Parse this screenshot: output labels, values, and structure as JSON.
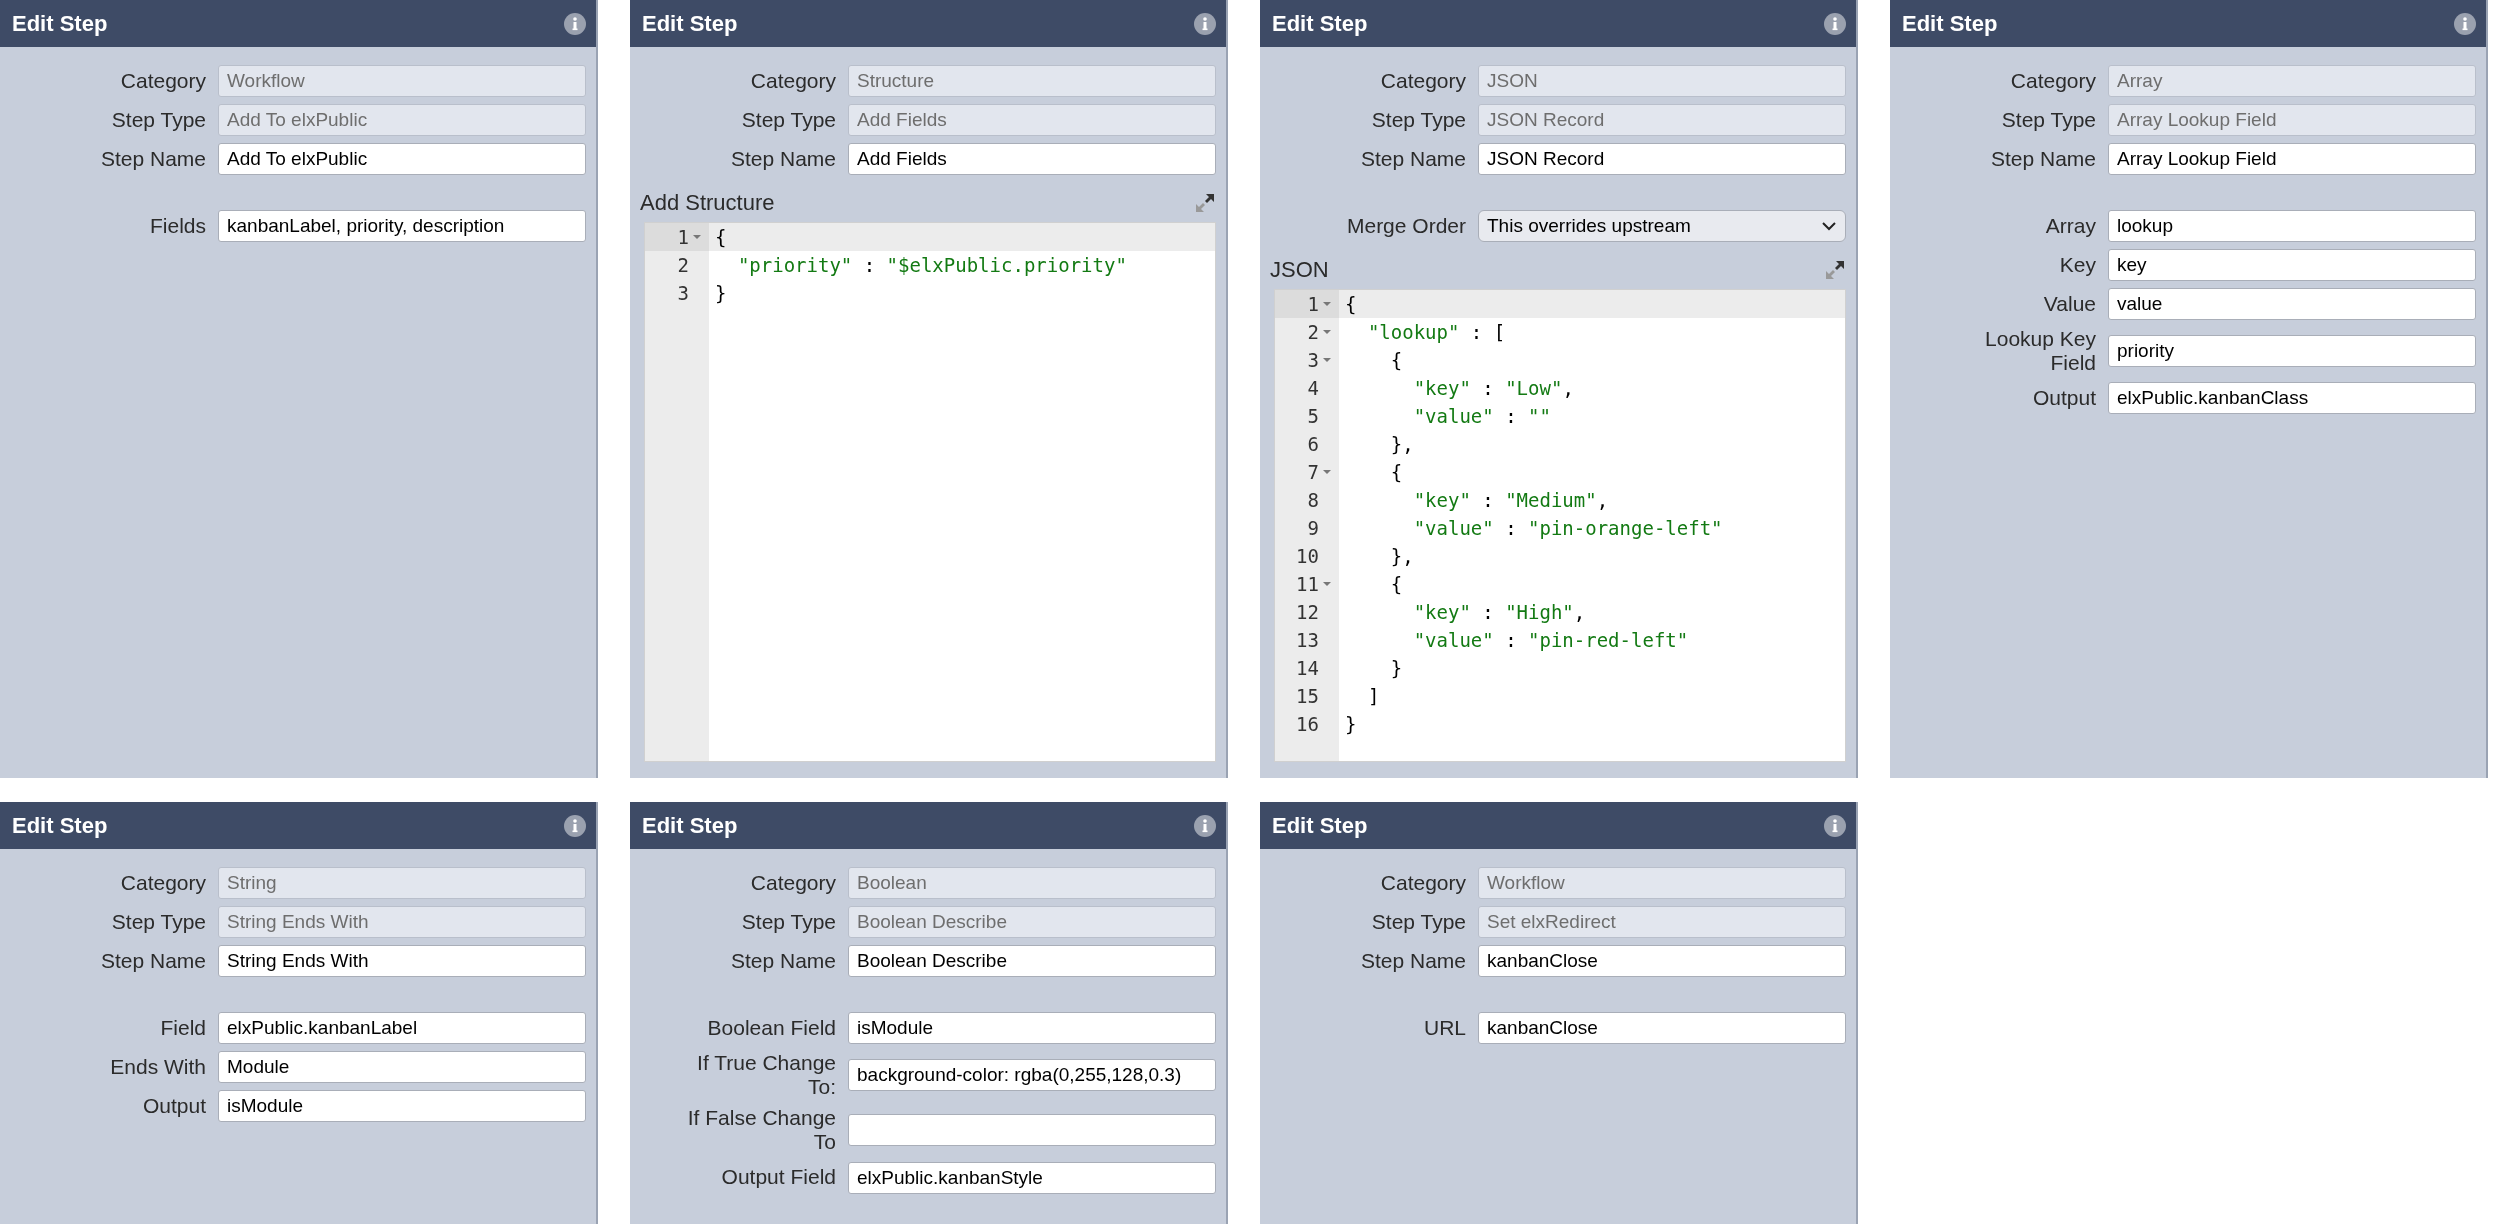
{
  "panels": [
    {
      "title": "Edit Step",
      "fields": [
        {
          "label": "Category",
          "value": "Workflow",
          "kind": "text",
          "readonly": true
        },
        {
          "label": "Step Type",
          "value": "Add To elxPublic",
          "kind": "text",
          "readonly": true
        },
        {
          "label": "Step Name",
          "value": "Add To elxPublic",
          "kind": "text",
          "readonly": false
        }
      ],
      "extra_fields": [
        {
          "label": "Fields",
          "value": "kanbanLabel, priority, description",
          "kind": "text",
          "readonly": false
        }
      ]
    },
    {
      "title": "Edit Step",
      "fields": [
        {
          "label": "Category",
          "value": "Structure",
          "kind": "text",
          "readonly": true
        },
        {
          "label": "Step Type",
          "value": "Add Fields",
          "kind": "text",
          "readonly": true
        },
        {
          "label": "Step Name",
          "value": "Add Fields",
          "kind": "text",
          "readonly": false
        }
      ],
      "editor": {
        "label": "Add Structure",
        "lines": [
          {
            "number": "1",
            "text": "{",
            "foldable": true,
            "active": true
          },
          {
            "number": "2",
            "text": "  \"priority\" : \"$elxPublic.priority\"",
            "foldable": false,
            "active": false
          },
          {
            "number": "3",
            "text": "}",
            "foldable": false,
            "active": false
          }
        ]
      }
    },
    {
      "title": "Edit Step",
      "fields": [
        {
          "label": "Category",
          "value": "JSON",
          "kind": "text",
          "readonly": true
        },
        {
          "label": "Step Type",
          "value": "JSON Record",
          "kind": "text",
          "readonly": true
        },
        {
          "label": "Step Name",
          "value": "JSON Record",
          "kind": "text",
          "readonly": false
        }
      ],
      "extra_fields": [
        {
          "label": "Merge Order",
          "value": "This overrides upstream",
          "kind": "select",
          "readonly": false
        }
      ],
      "editor": {
        "label": "JSON",
        "lines": [
          {
            "number": "1",
            "text": "{",
            "foldable": true,
            "active": true
          },
          {
            "number": "2",
            "text": "  \"lookup\" : [",
            "foldable": true,
            "active": false
          },
          {
            "number": "3",
            "text": "    {",
            "foldable": true,
            "active": false
          },
          {
            "number": "4",
            "text": "      \"key\" : \"Low\",",
            "foldable": false,
            "active": false
          },
          {
            "number": "5",
            "text": "      \"value\" : \"\"",
            "foldable": false,
            "active": false
          },
          {
            "number": "6",
            "text": "    },",
            "foldable": false,
            "active": false
          },
          {
            "number": "7",
            "text": "    {",
            "foldable": true,
            "active": false
          },
          {
            "number": "8",
            "text": "      \"key\" : \"Medium\",",
            "foldable": false,
            "active": false
          },
          {
            "number": "9",
            "text": "      \"value\" : \"pin-orange-left\"",
            "foldable": false,
            "active": false
          },
          {
            "number": "10",
            "text": "    },",
            "foldable": false,
            "active": false
          },
          {
            "number": "11",
            "text": "    {",
            "foldable": true,
            "active": false
          },
          {
            "number": "12",
            "text": "      \"key\" : \"High\",",
            "foldable": false,
            "active": false
          },
          {
            "number": "13",
            "text": "      \"value\" : \"pin-red-left\"",
            "foldable": false,
            "active": false
          },
          {
            "number": "14",
            "text": "    }",
            "foldable": false,
            "active": false
          },
          {
            "number": "15",
            "text": "  ]",
            "foldable": false,
            "active": false
          },
          {
            "number": "16",
            "text": "}",
            "foldable": false,
            "active": false
          }
        ]
      }
    },
    {
      "title": "Edit Step",
      "fields": [
        {
          "label": "Category",
          "value": "Array",
          "kind": "text",
          "readonly": true
        },
        {
          "label": "Step Type",
          "value": "Array Lookup Field",
          "kind": "text",
          "readonly": true
        },
        {
          "label": "Step Name",
          "value": "Array Lookup Field",
          "kind": "text",
          "readonly": false
        }
      ],
      "extra_fields": [
        {
          "label": "Array",
          "value": "lookup",
          "kind": "text",
          "readonly": false
        },
        {
          "label": "Key",
          "value": "key",
          "kind": "text",
          "readonly": false
        },
        {
          "label": "Value",
          "value": "value",
          "kind": "text",
          "readonly": false
        },
        {
          "label": "Lookup Key Field",
          "value": "priority",
          "kind": "text",
          "readonly": false
        },
        {
          "label": "Output",
          "value": "elxPublic.kanbanClass",
          "kind": "text",
          "readonly": false
        }
      ]
    },
    {
      "title": "Edit Step",
      "fields": [
        {
          "label": "Category",
          "value": "String",
          "kind": "text",
          "readonly": true
        },
        {
          "label": "Step Type",
          "value": "String Ends With",
          "kind": "text",
          "readonly": true
        },
        {
          "label": "Step Name",
          "value": "String Ends With",
          "kind": "text",
          "readonly": false
        }
      ],
      "extra_fields": [
        {
          "label": "Field",
          "value": "elxPublic.kanbanLabel",
          "kind": "text",
          "readonly": false
        },
        {
          "label": "Ends With",
          "value": "Module",
          "kind": "text",
          "readonly": false
        },
        {
          "label": "Output",
          "value": "isModule",
          "kind": "text",
          "readonly": false
        }
      ]
    },
    {
      "title": "Edit Step",
      "fields": [
        {
          "label": "Category",
          "value": "Boolean",
          "kind": "text",
          "readonly": true
        },
        {
          "label": "Step Type",
          "value": "Boolean Describe",
          "kind": "text",
          "readonly": true
        },
        {
          "label": "Step Name",
          "value": "Boolean Describe",
          "kind": "text",
          "readonly": false
        }
      ],
      "extra_fields": [
        {
          "label": "Boolean Field",
          "value": "isModule",
          "kind": "text",
          "readonly": false
        },
        {
          "label": "If True Change To:",
          "value": "background-color: rgba(0,255,128,0.3)",
          "kind": "text",
          "readonly": false
        },
        {
          "label": "If False Change To",
          "kind": "text",
          "readonly": false
        },
        {
          "label": "Output Field",
          "value": "elxPublic.kanbanStyle",
          "kind": "text",
          "readonly": false
        }
      ]
    },
    {
      "title": "Edit Step",
      "fields": [
        {
          "label": "Category",
          "value": "Workflow",
          "kind": "text",
          "readonly": true
        },
        {
          "label": "Step Type",
          "value": "Set elxRedirect",
          "kind": "text",
          "readonly": true
        },
        {
          "label": "Step Name",
          "value": "kanbanClose",
          "kind": "text",
          "readonly": false
        }
      ],
      "extra_fields": [
        {
          "label": "URL",
          "value": "kanbanClose",
          "kind": "text",
          "readonly": false
        }
      ]
    }
  ]
}
